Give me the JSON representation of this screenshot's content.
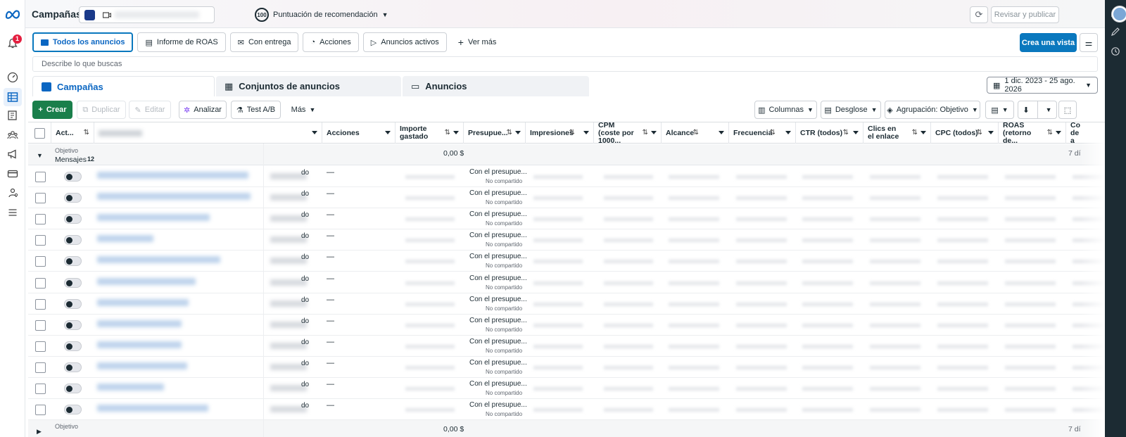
{
  "topbar": {
    "title": "Campañas",
    "score_value": "100",
    "score_label": "Puntuación de recomendación",
    "review_publish": "Revisar y publicar"
  },
  "notifications": {
    "count": "1"
  },
  "view_tabs": [
    {
      "label": "Todos los anuncios",
      "icon": "folder-icon"
    },
    {
      "label": "Informe de ROAS",
      "icon": "report-icon"
    },
    {
      "label": "Con entrega",
      "icon": "inbox-icon"
    },
    {
      "label": "Acciones",
      "icon": "actions-icon"
    },
    {
      "label": "Anuncios activos",
      "icon": "play-icon"
    },
    {
      "label": "Ver más",
      "icon": "plus-icon"
    }
  ],
  "create_view_label": "Crea una vista",
  "search_placeholder": "Describe lo que buscas",
  "levels": {
    "campaigns": "Campañas",
    "adsets": "Conjuntos de anuncios",
    "ads": "Anuncios"
  },
  "date_range": "1 dic. 2023 - 25 ago. 2026",
  "toolbar": {
    "create": "Crear",
    "duplicate": "Duplicar",
    "edit": "Editar",
    "analyze": "Analizar",
    "abtest": "Test A/B",
    "more": "Más",
    "columns": "Columnas",
    "breakdown": "Desglose",
    "grouping": "Agrupación: Objetivo"
  },
  "table": {
    "headers": {
      "activity": "Act...",
      "actions": "Acciones",
      "spent": "Importe gastado",
      "budget": "Presupue...",
      "impressions": "Impresiones",
      "cpm": "CPM (coste por 1000...",
      "reach": "Alcance",
      "frequency": "Frecuencia",
      "ctr": "CTR (todos)",
      "link_clicks": "Clics en el enlace",
      "cpc": "CPC (todos)",
      "roas": "ROAS (retorno de...",
      "last": "Co de a"
    },
    "group": {
      "objective_label": "Objetivo",
      "objective": "Mensajes",
      "count": "12",
      "spent": "0,00 $",
      "days": "7 dí"
    },
    "row_delivery_suffix": "do",
    "row_actions": "—",
    "row_budget": "Con el presupue...",
    "row_budget_note": "No compartido",
    "bottom_group": {
      "objective_label": "Objetivo",
      "spent": "0,00 $",
      "days": "7 dí"
    }
  }
}
